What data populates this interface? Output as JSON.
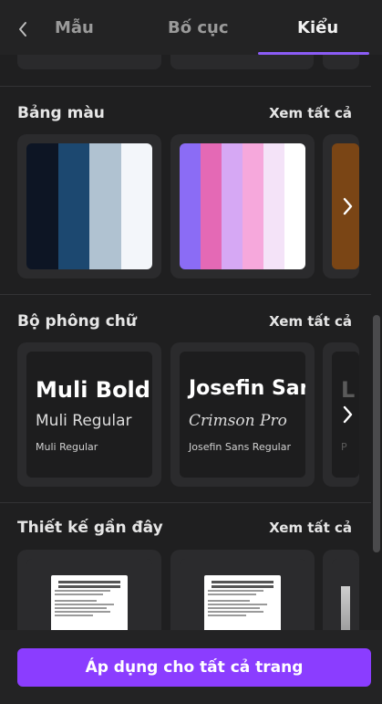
{
  "tabs": {
    "items": [
      {
        "label": "Mẫu"
      },
      {
        "label": "Bố cục"
      },
      {
        "label": "Kiểu"
      }
    ],
    "active_index": 2
  },
  "palette_section": {
    "title": "Bảng màu",
    "see_all": "Xem tất cả",
    "palettes": [
      {
        "colors": [
          "#0d1524",
          "#1c4870",
          "#b0c2d1",
          "#f3f6fa"
        ]
      },
      {
        "colors": [
          "#8b6cf5",
          "#e469b5",
          "#d6a8f4",
          "#f6a8dc",
          "#f4e3f8",
          "#ffffff"
        ]
      },
      {
        "colors": [
          "#7a4515"
        ]
      }
    ]
  },
  "font_section": {
    "title": "Bộ phông chữ",
    "see_all": "Xem tất cả",
    "sets": [
      {
        "heading": "Muli Bold",
        "subheading": "Muli Regular",
        "body": "Muli Regular"
      },
      {
        "heading": "Josefin Sans",
        "subheading": "Crimson Pro",
        "body": "Josefin Sans Regular"
      },
      {
        "heading": "L",
        "subheading": "",
        "body": "P"
      }
    ]
  },
  "recent_section": {
    "title": "Thiết kế gần đây",
    "see_all": "Xem tất cả"
  },
  "footer": {
    "apply_label": "Áp dụng cho tất cả trang"
  },
  "colors": {
    "accent": "#8b3dff",
    "tab_underline": "#8b5cf6",
    "background": "#1f1f20",
    "card": "#2b2b2d"
  },
  "icons": {
    "back": "chevron-left-icon",
    "next": "chevron-right-icon"
  }
}
